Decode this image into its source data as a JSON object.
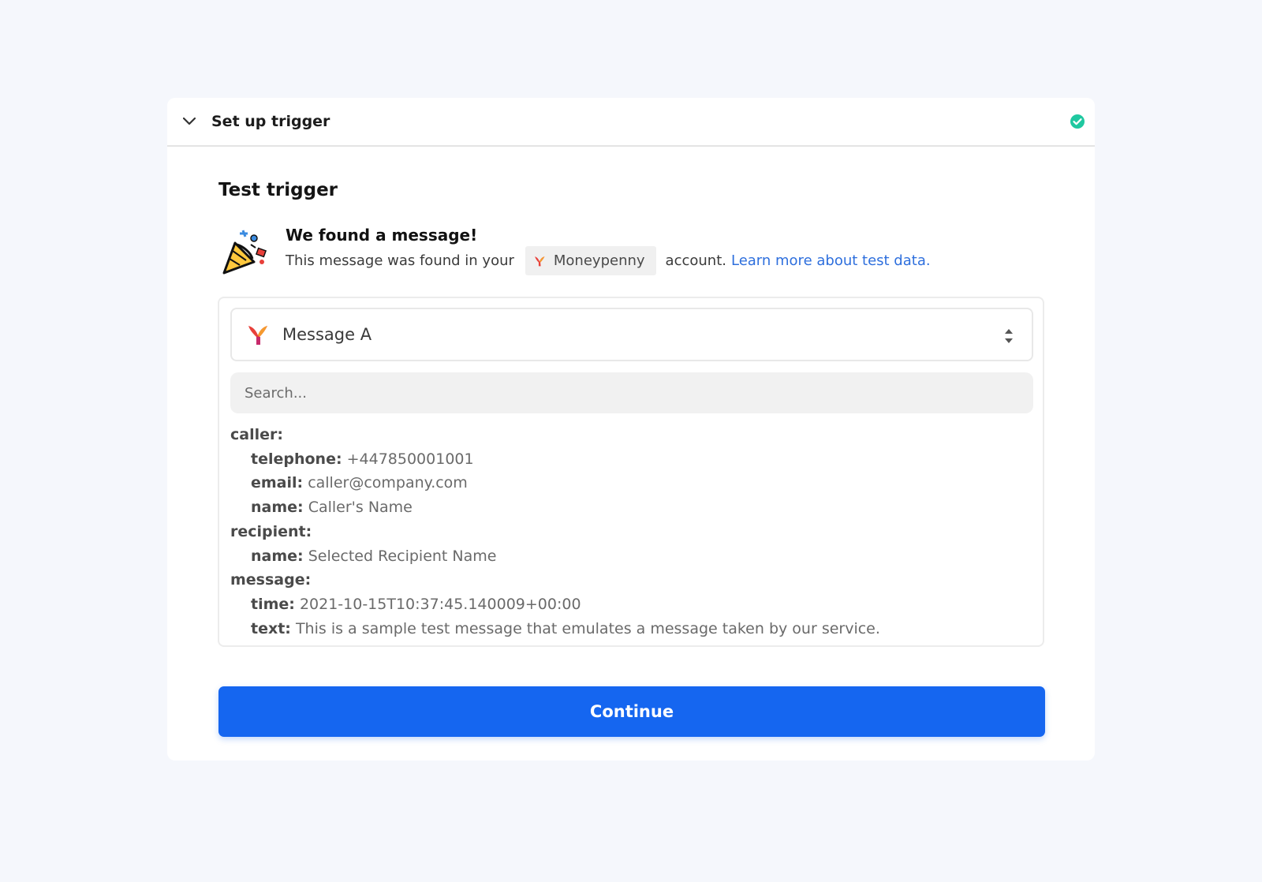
{
  "header": {
    "title": "Set up trigger",
    "status": "complete"
  },
  "section": {
    "title": "Test trigger"
  },
  "found": {
    "title": "We found a message!",
    "prefix": "This message was found in your",
    "account_name": "Moneypenny",
    "suffix": "account.",
    "link_text": "Learn more about test data."
  },
  "selector": {
    "value": "Message A"
  },
  "search": {
    "placeholder": "Search..."
  },
  "data_tree": {
    "caller": {
      "label": "caller:",
      "telephone_key": "telephone:",
      "telephone_val": "+447850001001",
      "email_key": "email:",
      "email_val": "caller@company.com",
      "name_key": "name:",
      "name_val": "Caller's Name"
    },
    "recipient": {
      "label": "recipient:",
      "name_key": "name:",
      "name_val": "Selected Recipient Name"
    },
    "message": {
      "label": "message:",
      "time_key": "time:",
      "time_val": "2021-10-15T10:37:45.140009+00:00",
      "text_key": "text:",
      "text_val": "This is a sample test message that emulates a message taken by our service."
    }
  },
  "actions": {
    "continue_label": "Continue"
  },
  "colors": {
    "primary": "#1566f0",
    "success": "#1fc8a0",
    "link": "#2e6fdd"
  }
}
